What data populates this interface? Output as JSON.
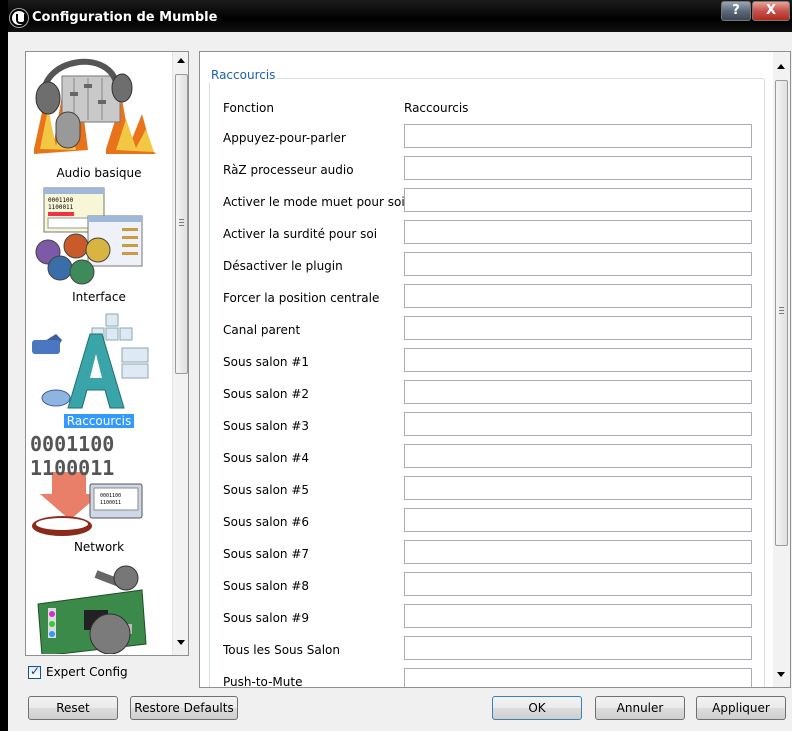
{
  "window": {
    "title": "Configuration de Mumble",
    "help_label": "?",
    "close_label": "X"
  },
  "sidebar": {
    "items": [
      {
        "label": "Audio basique",
        "icon": "audio-basic-icon",
        "selected": false
      },
      {
        "label": "Interface",
        "icon": "interface-icon",
        "selected": false
      },
      {
        "label": "Raccourcis",
        "icon": "shortcuts-icon",
        "selected": true
      },
      {
        "label": "Network",
        "icon": "network-icon",
        "selected": false
      },
      {
        "label": "",
        "icon": "audio-card-icon",
        "selected": false
      }
    ],
    "network_binary_1": "0001100",
    "network_binary_2": "1100011",
    "mini_binary": "0001100\n1100011"
  },
  "expert": {
    "label": "Expert Config",
    "checked": true
  },
  "shortcuts": {
    "group_title": "Raccourcis",
    "col_function": "Fonction",
    "col_shortcut": "Raccourcis",
    "rows": [
      {
        "label": "Appuyez-pour-parler",
        "value": ""
      },
      {
        "label": "RàZ processeur audio",
        "value": ""
      },
      {
        "label": "Activer le mode muet pour soi",
        "value": ""
      },
      {
        "label": "Activer la surdité pour soi",
        "value": ""
      },
      {
        "label": "Désactiver le plugin",
        "value": ""
      },
      {
        "label": "Forcer la position centrale",
        "value": ""
      },
      {
        "label": "Canal parent",
        "value": ""
      },
      {
        "label": "Sous salon #1",
        "value": ""
      },
      {
        "label": "Sous salon #2",
        "value": ""
      },
      {
        "label": "Sous salon #3",
        "value": ""
      },
      {
        "label": "Sous salon #4",
        "value": ""
      },
      {
        "label": "Sous salon #5",
        "value": ""
      },
      {
        "label": "Sous salon #6",
        "value": ""
      },
      {
        "label": "Sous salon #7",
        "value": ""
      },
      {
        "label": "Sous salon #8",
        "value": ""
      },
      {
        "label": "Sous salon #9",
        "value": ""
      },
      {
        "label": "Tous les Sous Salon",
        "value": ""
      },
      {
        "label": "Push-to-Mute",
        "value": ""
      }
    ]
  },
  "buttons": {
    "reset": "Reset",
    "restore_defaults": "Restore Defaults",
    "ok": "OK",
    "cancel": "Annuler",
    "apply": "Appliquer"
  },
  "colors": {
    "selection": "#3399ff",
    "group_title": "#1a5fb4",
    "titlebar": "#000000"
  }
}
